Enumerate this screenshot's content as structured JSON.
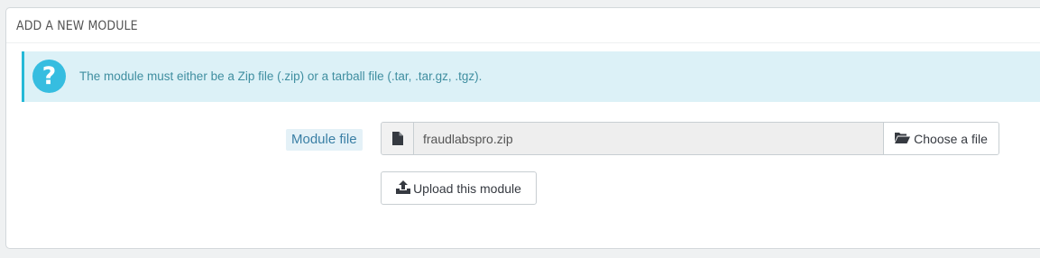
{
  "panel": {
    "title": "ADD A NEW MODULE"
  },
  "alert": {
    "icon": "question-circle-icon",
    "text": "The module must either be a Zip file (.zip) or a tarball file (.tar, .tar.gz, .tgz)."
  },
  "form": {
    "field_label": "Module file",
    "file_icon": "file-icon",
    "file_value": "fraudlabspro.zip",
    "choose_button": {
      "icon": "folder-open-icon",
      "label": "Choose a file"
    },
    "upload_button": {
      "icon": "upload-icon",
      "label": "Upload this module"
    }
  },
  "colors": {
    "alert_background": "#dcf1f7",
    "alert_accent": "#25b9d7",
    "alert_text": "#3f8ea0",
    "label_text": "#3a7fa5"
  }
}
